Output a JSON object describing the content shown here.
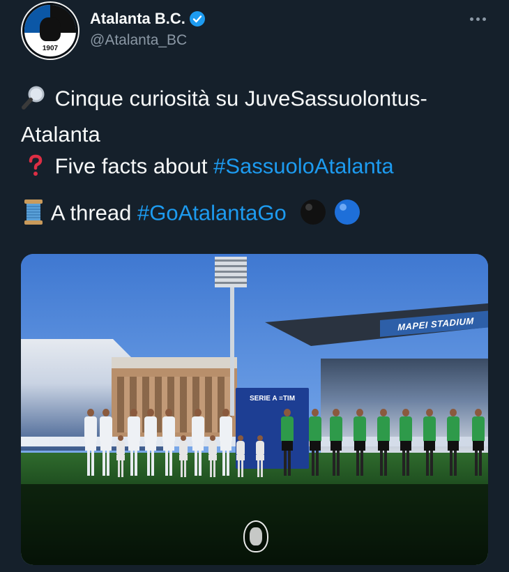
{
  "tweet": {
    "author": {
      "display_name": "Atalanta B.C.",
      "handle": "@Atalanta_BC",
      "verified": true,
      "avatar": {
        "icon": "atalanta-crest-icon",
        "year": "1907"
      }
    },
    "text": {
      "line1": {
        "emoji": "magnifying-glass-icon",
        "text": "Cinque curiosità su JuveSassuolontus-"
      },
      "line2": {
        "text": "Atalanta"
      },
      "line3": {
        "emoji": "red-question-mark-icon",
        "text": "Five facts about ",
        "hashtag": "#SassuoloAtalanta"
      },
      "line4": {
        "emoji": "thread-spool-icon",
        "text": "A thread ",
        "hashtag": "#GoAtalantaGo",
        "emoji_after": [
          "black-circle-icon",
          "blue-circle-icon"
        ]
      }
    },
    "media": {
      "stadium_sign": "MAPEI STADIUM",
      "serie_a_board": "SERIE A ≡TIM",
      "watermark_icon": "atalanta-crest-icon"
    }
  },
  "colors": {
    "background": "#15202b",
    "text": "#f7f9f9",
    "secondary_text": "#8b98a5",
    "link": "#1d9bf0",
    "verified": "#1d9bf0"
  }
}
